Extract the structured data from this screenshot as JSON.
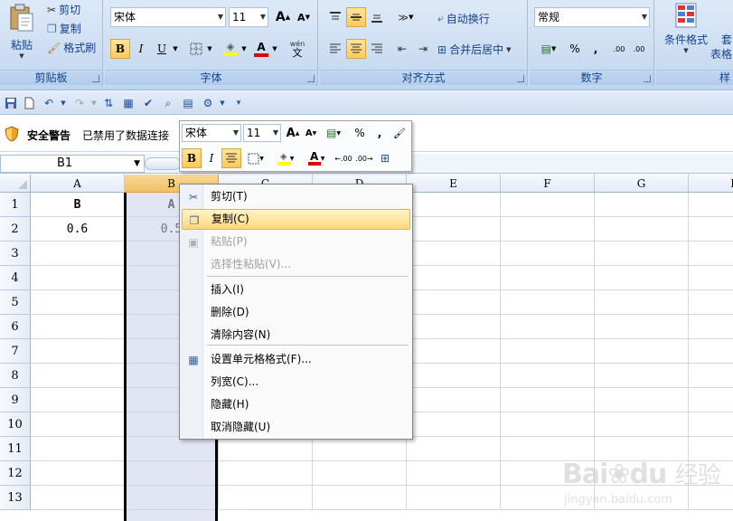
{
  "ribbon": {
    "clipboard": {
      "label": "剪贴板",
      "paste": "粘贴",
      "cut": "剪切",
      "copy": "复制",
      "format_painter": "格式刷"
    },
    "font": {
      "label": "字体",
      "font_name": "宋体",
      "font_size": "11",
      "bold": "B",
      "italic": "I",
      "underline": "U",
      "grow": "A",
      "shrink": "A",
      "color_letter": "A",
      "phonetic": "wén"
    },
    "alignment": {
      "label": "对齐方式",
      "wrap_text": "自动换行",
      "merge_center": "合并后居中"
    },
    "number": {
      "label": "数字",
      "format": "常规",
      "percent": "%",
      "comma": ",",
      "inc_decimal": ".00",
      "dec_decimal": ".00"
    },
    "styles": {
      "conditional": "条件格式",
      "table_partial_1": "套",
      "table_partial_2": "表格",
      "style_partial": "样"
    }
  },
  "security_bar": {
    "title": "安全警告",
    "message": "已禁用了数据连接"
  },
  "mini_toolbar": {
    "font_name": "宋体",
    "font_size": "11",
    "bold": "B",
    "italic": "I",
    "percent": "%",
    "comma": ",",
    "color_letter": "A"
  },
  "name_box": {
    "value": "B1"
  },
  "columns": [
    "A",
    "B",
    "C",
    "D",
    "E",
    "F",
    "G",
    "H"
  ],
  "rows": [
    "1",
    "2",
    "3",
    "4",
    "5",
    "6",
    "7",
    "8",
    "9",
    "10",
    "11",
    "12",
    "13"
  ],
  "cells": {
    "A1": "B",
    "B1": "A",
    "A2": "0.6",
    "B2": "0.5"
  },
  "context_menu": {
    "items": [
      {
        "label": "剪切(T)",
        "icon": "scissors-icon"
      },
      {
        "label": "复制(C)",
        "icon": "copy-icon"
      },
      {
        "label": "粘贴(P)",
        "icon": "paste-icon"
      },
      {
        "label": "选择性粘贴(V)...",
        "icon": ""
      },
      {
        "label": "插入(I)",
        "icon": ""
      },
      {
        "label": "删除(D)",
        "icon": ""
      },
      {
        "label": "清除内容(N)",
        "icon": ""
      },
      {
        "label": "设置单元格格式(F)...",
        "icon": "format-cells-icon"
      },
      {
        "label": "列宽(C)...",
        "icon": ""
      },
      {
        "label": "隐藏(H)",
        "icon": ""
      },
      {
        "label": "取消隐藏(U)",
        "icon": ""
      }
    ]
  },
  "watermark": {
    "brand": "Bai",
    "brand2": "du",
    "cn": "经验",
    "url": "jingyan.baidu.com"
  },
  "colors": {
    "accent": "#ffc95a",
    "selected_col": "#dfe3f0",
    "ribbon": "#c9dbf1"
  }
}
